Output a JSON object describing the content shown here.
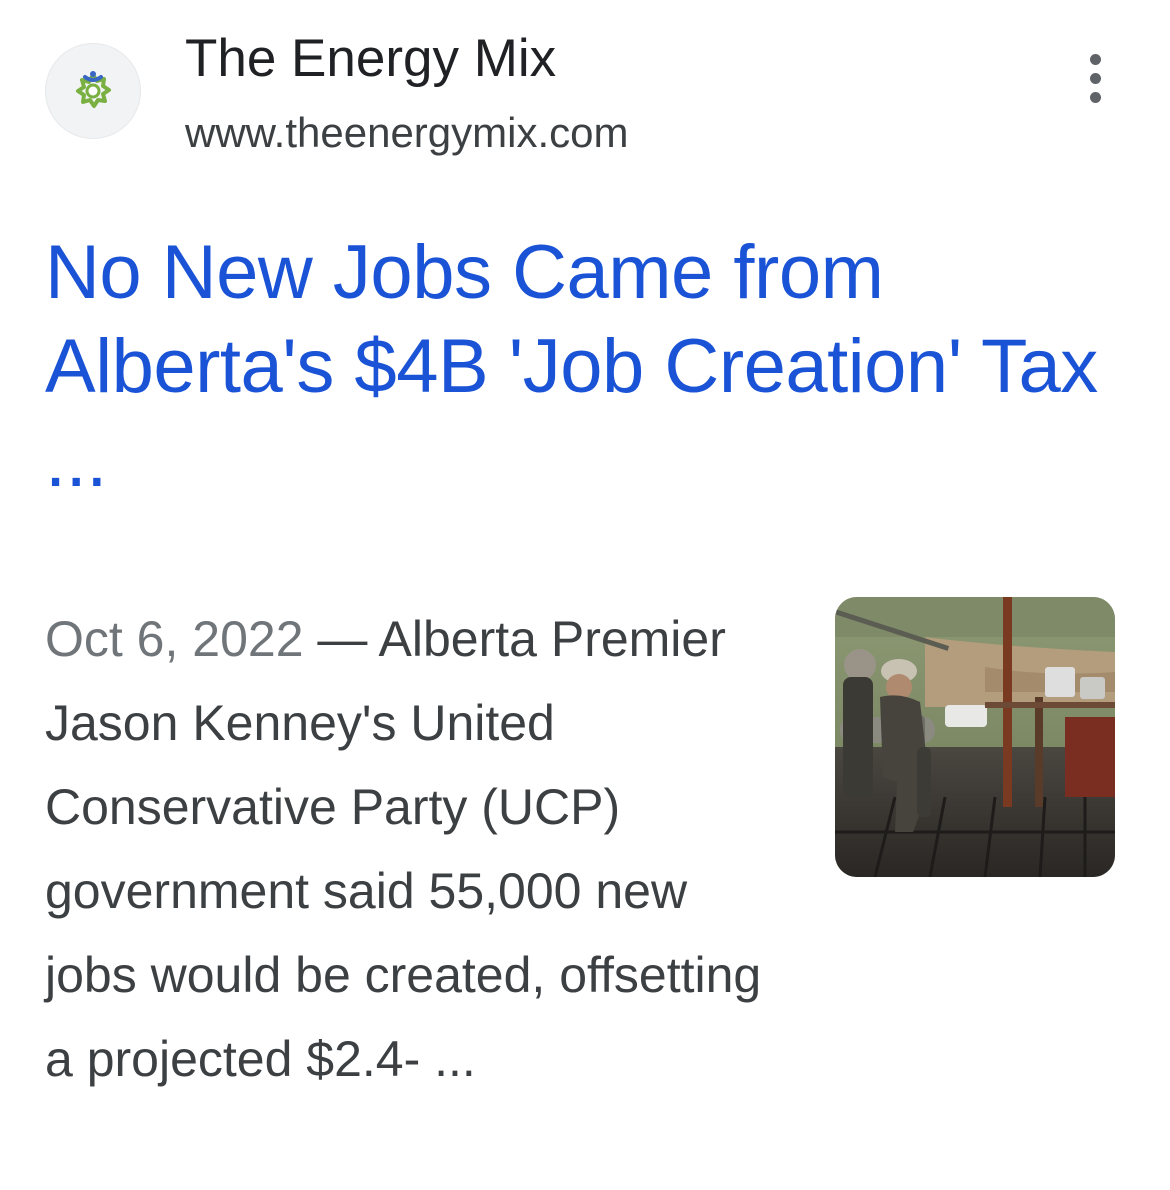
{
  "site": {
    "name": "The Energy Mix",
    "url": "www.theenergymix.com",
    "favicon_icon": "energy-mix-logo-icon"
  },
  "menu": {
    "icon": "more-vert-icon"
  },
  "result": {
    "title": "No New Jobs Came from Alberta's $4B 'Job Creation' Tax ...",
    "date": "Oct 6, 2022",
    "separator": " — ",
    "snippet": "Alberta Premier Jason Kenney's United Conservative Party (UCP) government said 55,000 new jobs would be created, offsetting a projected $2.4- ...",
    "thumbnail_icon": "oil-rig-workers-photo"
  },
  "colors": {
    "title_link": "#1a53d6",
    "site_name": "#202124",
    "body_text": "#3c4043",
    "date_text": "#70757a"
  }
}
